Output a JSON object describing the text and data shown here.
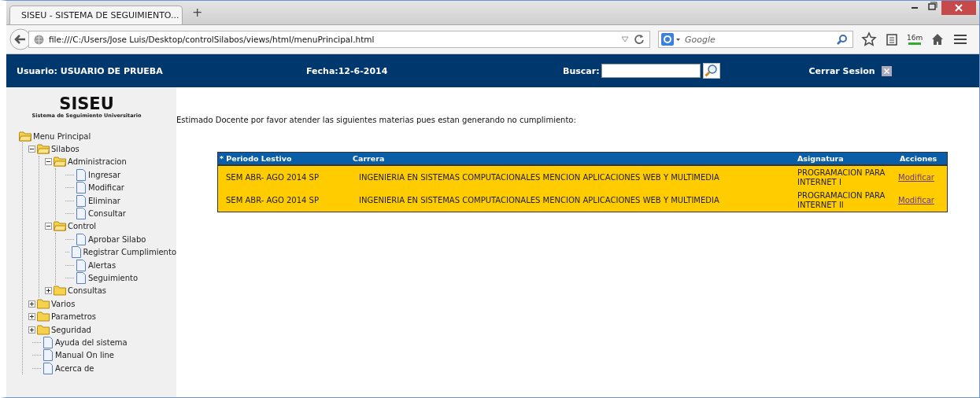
{
  "browser": {
    "tab_title": "SISEU - SISTEMA DE SEGUIMIENTO...",
    "new_tab": "+",
    "url": "file:///C:/Users/Jose Luis/Desktop/controlSilabos/views/html/menuPrincipal.html",
    "search_placeholder": "Google",
    "download_badge": "16m"
  },
  "header": {
    "user": "Usuario: USUARIO DE PRUEBA",
    "date": "Fecha:12-6-2014",
    "search_label": "Buscar:",
    "logout": "Cerrar Sesion"
  },
  "sidebar": {
    "logo": "SISEU",
    "subtitle": "Sistema de Seguimiento Universitario",
    "tree": [
      {
        "kind": "root",
        "label": "Menu Principal",
        "children": [
          {
            "kind": "folder",
            "label": "Silabos",
            "expanded": true,
            "children": [
              {
                "kind": "folder",
                "label": "Administracion",
                "expanded": true,
                "children": [
                  {
                    "kind": "page",
                    "label": "Ingresar"
                  },
                  {
                    "kind": "page",
                    "label": "Modificar"
                  },
                  {
                    "kind": "page",
                    "label": "Eliminar"
                  },
                  {
                    "kind": "page",
                    "label": "Consultar"
                  }
                ]
              },
              {
                "kind": "folder",
                "label": "Control",
                "expanded": true,
                "children": [
                  {
                    "kind": "page",
                    "label": "Aprobar Silabo"
                  },
                  {
                    "kind": "page",
                    "label": "Registrar Cumplimiento"
                  },
                  {
                    "kind": "page",
                    "label": "Alertas"
                  },
                  {
                    "kind": "page",
                    "label": "Seguimiento"
                  }
                ]
              },
              {
                "kind": "folder",
                "label": "Consultas",
                "expanded": false
              }
            ]
          },
          {
            "kind": "folder",
            "label": "Varios",
            "expanded": false
          },
          {
            "kind": "folder",
            "label": "Parametros",
            "expanded": false
          },
          {
            "kind": "folder",
            "label": "Seguridad",
            "expanded": false
          },
          {
            "kind": "page",
            "label": "Ayuda del sistema"
          },
          {
            "kind": "page",
            "label": "Manual On line"
          },
          {
            "kind": "page",
            "label": "Acerca de"
          }
        ]
      }
    ]
  },
  "message": "Estimado Docente por favor atender las siguientes materias pues estan generando no cumplimiento:",
  "table": {
    "columns": [
      "* Periodo Lestivo",
      "Carrera",
      "Asignatura",
      "Acciones"
    ],
    "rows": [
      {
        "periodo": "SEM ABR- AGO 2014 SP",
        "carrera": "INGENIERIA EN SISTEMAS COMPUTACIONALES MENCION APLICACIONES WEB Y MULTIMEDIA",
        "asignatura": "PROGRAMACION PARA INTERNET I",
        "action": "Modificar"
      },
      {
        "periodo": "SEM ABR- AGO 2014 SP",
        "carrera": "INGENIERIA EN SISTEMAS COMPUTACIONALES MENCION APLICACIONES WEB Y MULTIMEDIA",
        "asignatura": "PROGRAMACION PARA INTERNET II",
        "action": "Modificar"
      }
    ]
  }
}
